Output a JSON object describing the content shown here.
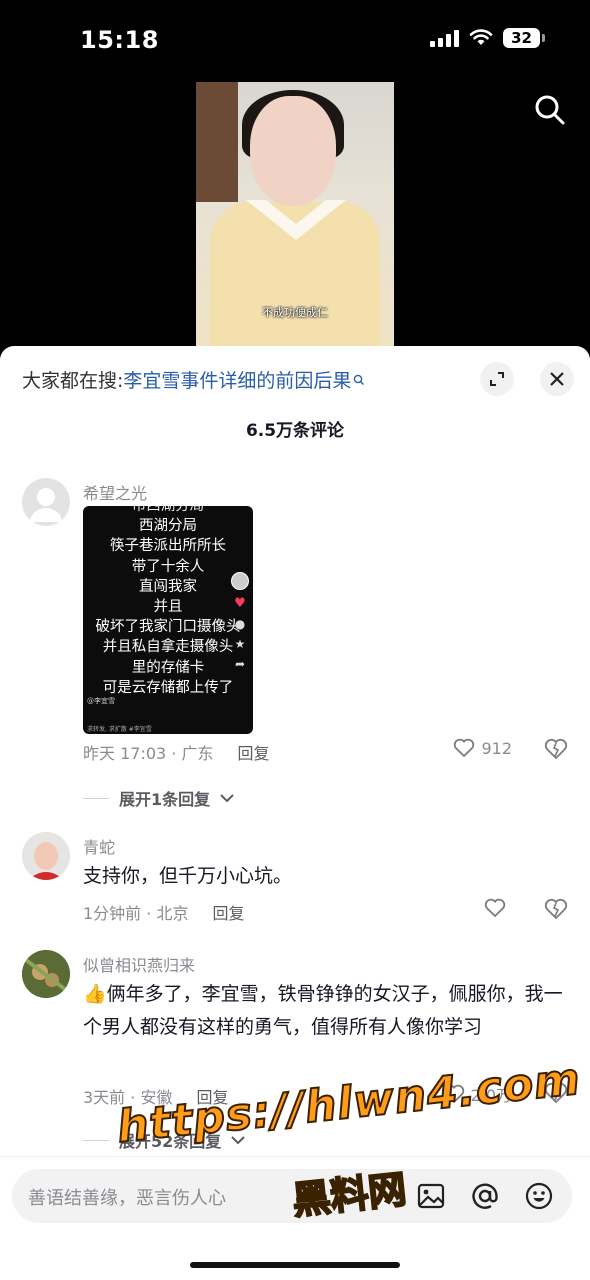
{
  "status_bar": {
    "time": "15:18",
    "battery": "32"
  },
  "video": {
    "subtitle": "不成功便成仁"
  },
  "sheet": {
    "everyone_search_prefix": "大家都在搜:",
    "everyone_search_query": "李宜雪事件详细的前因后果",
    "comment_count": "6.5万条评论"
  },
  "comments": [
    {
      "username": "希望之光",
      "image_lines": [
        "市西湖分局",
        "西湖分局",
        "筷子巷派出所所长",
        "带了十余人",
        "直闯我家",
        "并且",
        "破坏了我家门口摄像头",
        "并且私自拿走摄像头",
        "里的存储卡",
        "可是云存储都上传了"
      ],
      "image_author": "@李宜雪",
      "image_tag": "求转发, 求扩散 #李宜雪",
      "time_location": "昨天 17:03 · 广东",
      "reply": "回复",
      "likes": "912",
      "expand_label": "展开1条回复"
    },
    {
      "username": "青蛇",
      "text": "支持你，但千万小心坑。",
      "time_location": "1分钟前 · 北京",
      "reply": "回复",
      "likes": ""
    },
    {
      "username": "似曾相识燕归来",
      "text": "👍俩年多了，李宜雪，铁骨铮铮的女汉子，佩服你，我一个男人都没有这样的勇气，值得所有人像你学习",
      "time_location": "3天前 · 安徽",
      "reply": "回复",
      "likes": "2.0万",
      "expand_label": "展开52条回复"
    }
  ],
  "input": {
    "placeholder": "善语结善缘，恶言伤人心"
  },
  "watermark": {
    "url": "https://hlwn4.com",
    "brand": "黑料网"
  }
}
